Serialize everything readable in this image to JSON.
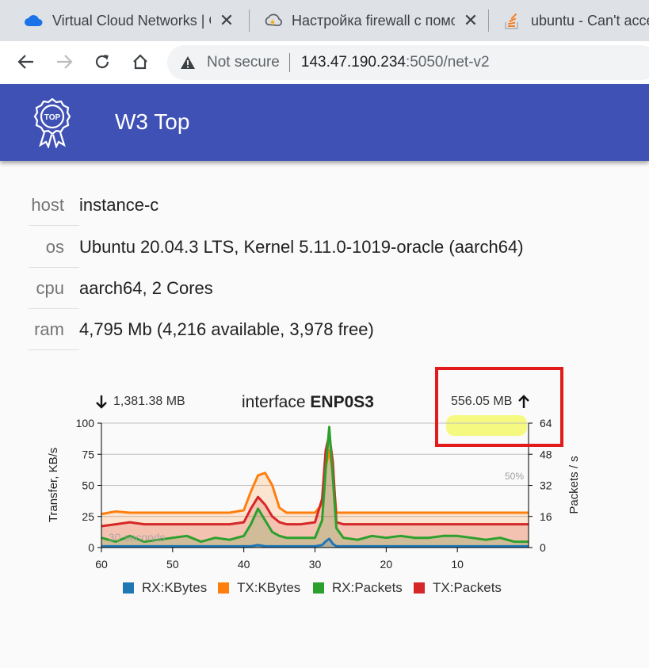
{
  "browser": {
    "tabs": [
      {
        "title": "Virtual Cloud Networks | O",
        "icon": "cloud-icon"
      },
      {
        "title": "Настройка firewall с помо",
        "icon": "bolt-icon"
      },
      {
        "title": "ubuntu - Can't acce",
        "icon": "stackoverflow-icon"
      }
    ],
    "security_label": "Not secure",
    "url_host": "143.47.190.234",
    "url_rest": ":5050/net-v2"
  },
  "app": {
    "title": "W3 Top",
    "logo_text": "TOP"
  },
  "info": [
    {
      "key": "host",
      "value": "instance-c"
    },
    {
      "key": "os",
      "value": "Ubuntu 20.04.3 LTS, Kernel 5.11.0-1019-oracle (aarch64)"
    },
    {
      "key": "cpu",
      "value": "aarch64, 2 Cores"
    },
    {
      "key": "ram",
      "value": "4,795 Mb (4,216 available, 3,978 free)"
    }
  ],
  "interface": {
    "title_prefix": "interface",
    "name": "ENP0S3",
    "rx_total": "1,381.38 MB",
    "tx_total": "556.05 MB"
  },
  "colors": {
    "header": "#3f51b5",
    "rx_kbytes": "#1f77b4",
    "tx_kbytes": "#ff7f0e",
    "rx_packets": "#2ca02c",
    "tx_packets": "#d62728",
    "annotation_box": "#e21c1c"
  },
  "chart_data": {
    "type": "line",
    "title": "interface ENP0S3",
    "xlabel": "",
    "ylabel": "Transfer, KB/s",
    "ylabel_right": "Packets / s",
    "x_ticks": [
      "60",
      "50",
      "40",
      "30",
      "20",
      "10"
    ],
    "y_ticks": [
      "100",
      "75",
      "50",
      "25",
      "0"
    ],
    "y2_ticks": [
      "64",
      "48",
      "32",
      "16",
      "0"
    ],
    "xlim": [
      60,
      0
    ],
    "ylim": [
      0,
      100
    ],
    "y2lim": [
      0,
      64
    ],
    "annotations": [
      "50%",
      "30 seconds"
    ],
    "grid": true,
    "legend_position": "bottom",
    "x": [
      60,
      58,
      56,
      54,
      52,
      50,
      48,
      46,
      44,
      42,
      40,
      39,
      38,
      37,
      36,
      35,
      34,
      32,
      30,
      29,
      28.5,
      28,
      27.5,
      27,
      26,
      24,
      22,
      20,
      18,
      16,
      14,
      12,
      10,
      8,
      6,
      4,
      2,
      0
    ],
    "series": [
      {
        "name": "RX:KBytes",
        "axis": "left",
        "values": [
          1,
          1,
          1,
          1,
          1,
          1,
          1,
          1,
          1,
          1,
          1,
          1,
          2,
          1,
          1,
          1,
          1,
          1,
          1,
          2,
          5,
          7,
          3,
          1,
          1,
          1,
          1,
          1,
          1,
          1,
          1,
          1,
          1,
          1,
          1,
          1,
          1,
          1
        ]
      },
      {
        "name": "TX:KBytes",
        "axis": "left",
        "values": [
          27,
          29,
          28,
          28,
          28,
          28,
          28,
          28,
          28,
          28,
          30,
          45,
          58,
          60,
          50,
          32,
          28,
          28,
          28,
          35,
          65,
          78,
          60,
          28,
          28,
          28,
          28,
          28,
          28,
          28,
          28,
          28,
          28,
          28,
          28,
          28,
          28,
          28
        ]
      },
      {
        "name": "RX:Packets",
        "axis": "right",
        "values": [
          5,
          3,
          6,
          3,
          4,
          5,
          6,
          3,
          5,
          4,
          6,
          12,
          20,
          14,
          8,
          6,
          5,
          5,
          5,
          14,
          40,
          62,
          36,
          10,
          5,
          4,
          6,
          5,
          6,
          5,
          5,
          6,
          6,
          5,
          4,
          5,
          3,
          3
        ]
      },
      {
        "name": "TX:Packets",
        "axis": "right",
        "values": [
          11,
          12,
          13,
          12,
          12,
          12,
          12,
          12,
          12,
          12,
          13,
          20,
          26,
          22,
          16,
          13,
          12,
          12,
          13,
          25,
          50,
          58,
          44,
          13,
          12,
          12,
          12,
          12,
          12,
          12,
          12,
          12,
          12,
          12,
          12,
          12,
          12,
          12
        ]
      }
    ]
  }
}
